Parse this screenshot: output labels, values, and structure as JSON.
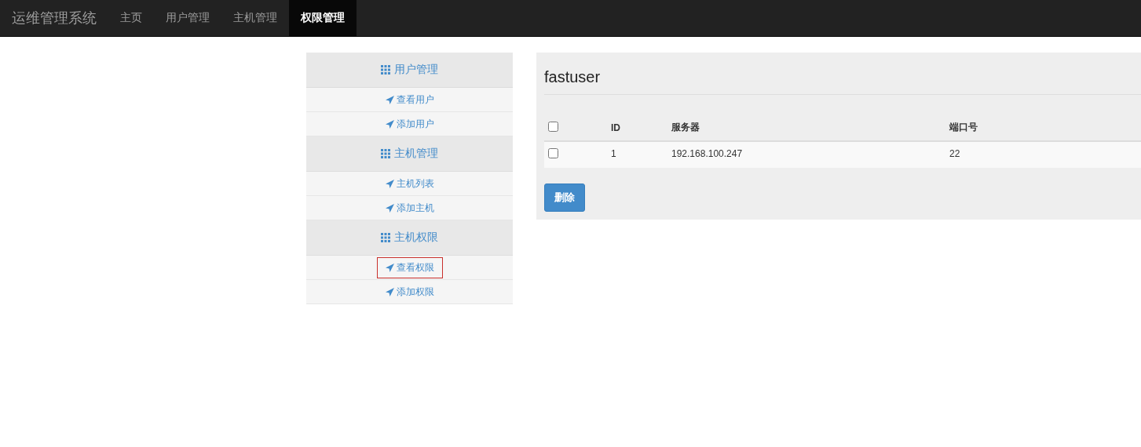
{
  "navbar": {
    "brand": "运维管理系统",
    "items": [
      {
        "label": "主页",
        "selected": false
      },
      {
        "label": "用户管理",
        "selected": false
      },
      {
        "label": "主机管理",
        "selected": false
      },
      {
        "label": "权限管理",
        "selected": true
      }
    ]
  },
  "sidebar": {
    "groups": [
      {
        "title": "用户管理",
        "items": [
          {
            "label": "查看用户",
            "highlighted": false
          },
          {
            "label": "添加用户",
            "highlighted": false
          }
        ]
      },
      {
        "title": "主机管理",
        "items": [
          {
            "label": "主机列表",
            "highlighted": false
          },
          {
            "label": "添加主机",
            "highlighted": false
          }
        ]
      },
      {
        "title": "主机权限",
        "items": [
          {
            "label": "查看权限",
            "highlighted": true
          },
          {
            "label": "添加权限",
            "highlighted": false
          }
        ]
      }
    ]
  },
  "content": {
    "title": "fastuser",
    "table": {
      "select_all_checked": false,
      "columns": [
        "ID",
        "服务器",
        "端口号"
      ],
      "rows": [
        {
          "checked": false,
          "cells": [
            "1",
            "192.168.100.247",
            "22"
          ]
        }
      ]
    },
    "delete_button": "删除"
  }
}
